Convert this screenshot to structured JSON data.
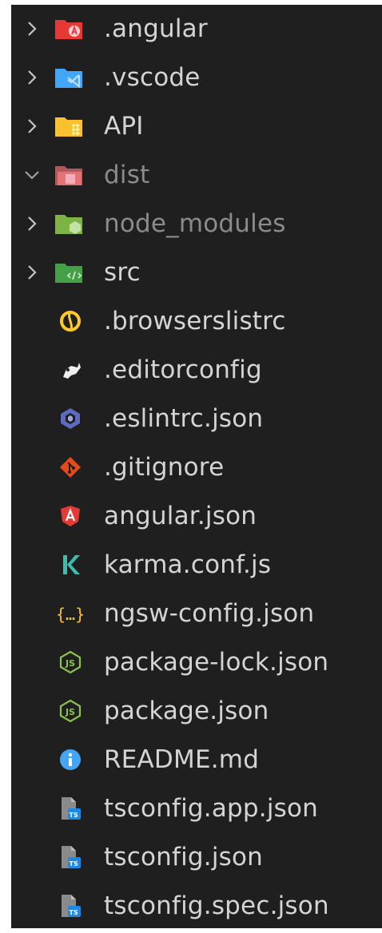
{
  "colors": {
    "background": "#1f1f1f",
    "text": "#d4d4d4",
    "text_dimmed": "#8b8b8b"
  },
  "explorer": {
    "items": [
      {
        "label": ".angular",
        "type": "folder",
        "expanded": false,
        "dimmed": false,
        "icon": "angular-folder-icon"
      },
      {
        "label": ".vscode",
        "type": "folder",
        "expanded": false,
        "dimmed": false,
        "icon": "vscode-folder-icon"
      },
      {
        "label": "API",
        "type": "folder",
        "expanded": false,
        "dimmed": false,
        "icon": "api-folder-icon"
      },
      {
        "label": "dist",
        "type": "folder",
        "expanded": true,
        "dimmed": true,
        "icon": "dist-folder-icon"
      },
      {
        "label": "node_modules",
        "type": "folder",
        "expanded": false,
        "dimmed": true,
        "icon": "node-folder-icon"
      },
      {
        "label": "src",
        "type": "folder",
        "expanded": false,
        "dimmed": false,
        "icon": "src-folder-icon"
      },
      {
        "label": ".browserslistrc",
        "type": "file",
        "dimmed": false,
        "icon": "browserslist-icon"
      },
      {
        "label": ".editorconfig",
        "type": "file",
        "dimmed": false,
        "icon": "editorconfig-icon"
      },
      {
        "label": ".eslintrc.json",
        "type": "file",
        "dimmed": false,
        "icon": "eslint-icon"
      },
      {
        "label": ".gitignore",
        "type": "file",
        "dimmed": false,
        "icon": "git-icon"
      },
      {
        "label": "angular.json",
        "type": "file",
        "dimmed": false,
        "icon": "angular-icon"
      },
      {
        "label": "karma.conf.js",
        "type": "file",
        "dimmed": false,
        "icon": "karma-icon"
      },
      {
        "label": "ngsw-config.json",
        "type": "file",
        "dimmed": false,
        "icon": "json-braces-icon"
      },
      {
        "label": "package-lock.json",
        "type": "file",
        "dimmed": false,
        "icon": "nodejs-icon"
      },
      {
        "label": "package.json",
        "type": "file",
        "dimmed": false,
        "icon": "nodejs-icon"
      },
      {
        "label": "README.md",
        "type": "file",
        "dimmed": false,
        "icon": "info-icon"
      },
      {
        "label": "tsconfig.app.json",
        "type": "file",
        "dimmed": false,
        "icon": "tsconfig-icon"
      },
      {
        "label": "tsconfig.json",
        "type": "file",
        "dimmed": false,
        "icon": "tsconfig-icon"
      },
      {
        "label": "tsconfig.spec.json",
        "type": "file",
        "dimmed": false,
        "icon": "tsconfig-icon"
      }
    ]
  }
}
